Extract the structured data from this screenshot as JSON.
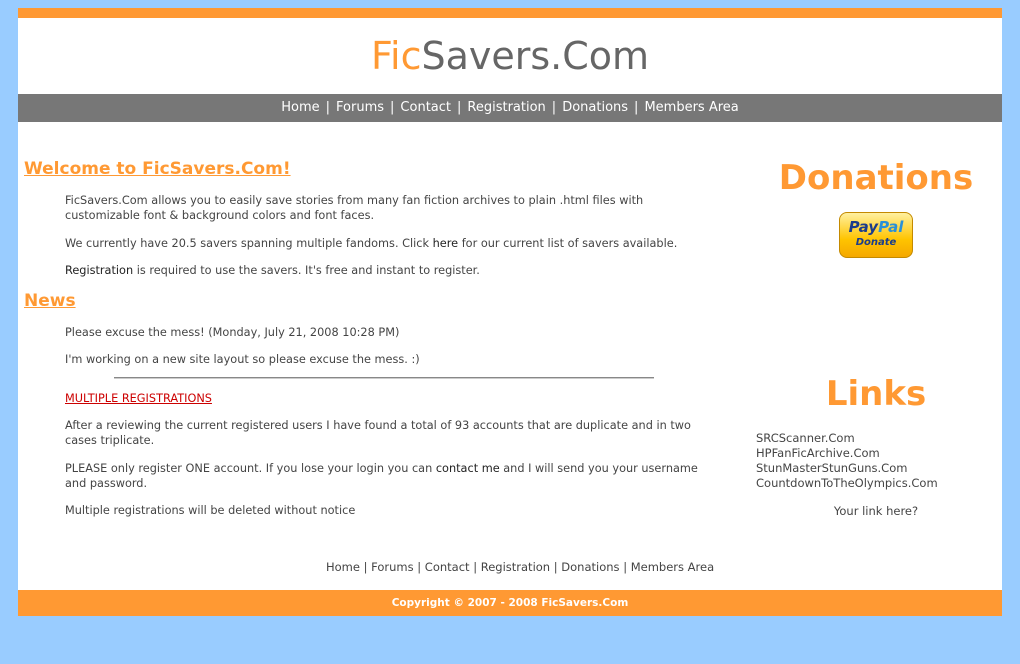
{
  "site": {
    "title_part1": "Fic",
    "title_part2": "Savers.Com",
    "colors": {
      "background": "#99ccff",
      "accent": "#ff9933",
      "nav": "#777777"
    }
  },
  "nav": {
    "items": [
      "Home",
      "Forums",
      "Contact",
      "Registration",
      "Donations",
      "Members Area"
    ],
    "separator": "|"
  },
  "main": {
    "welcome_heading": "Welcome to FicSavers.Com!",
    "welcome_p1": "FicSavers.Com allows you to easily save stories from many fan fiction archives to plain .html files with customizable font & background colors and font faces.",
    "welcome_p2_a": "We currently have 20.5 savers spanning multiple fandoms. Click ",
    "welcome_p2_link": "here",
    "welcome_p2_b": " for our current list of savers available.",
    "welcome_p3_link": "Registration",
    "welcome_p3_b": " is required to use the savers. It's free and instant to register.",
    "news_heading": "News",
    "news1_title": "Please excuse the mess! (Monday, July 21, 2008 10:28 PM)",
    "news1_body": "I'm working on a new site layout so please excuse the mess. :)",
    "news2_title": "MULTIPLE REGISTRATIONS",
    "news2_p1": "After a reviewing the current registered users I have found a total of 93 accounts that are duplicate and in two cases triplicate.",
    "news2_p2_a": "PLEASE only register ONE account. If you lose your login you can ",
    "news2_p2_link": "contact me",
    "news2_p2_b": " and I will send you your username and password.",
    "news2_p3": "Multiple registrations will be deleted without notice"
  },
  "sidebar": {
    "donations_heading": "Donations",
    "paypal_pay": "Pay",
    "paypal_pal": "Pal",
    "paypal_donate": "Donate",
    "links_heading": "Links",
    "links": [
      "SRCScanner.Com",
      "HPFanFicArchive.Com",
      "StunMasterStunGuns.Com",
      "CountdownToTheOlympics.Com"
    ],
    "your_link": "Your link here?"
  },
  "footer": {
    "nav": [
      "Home",
      "Forums",
      "Contact",
      "Registration",
      "Donations",
      "Members Area"
    ],
    "separator": "|",
    "copyright": "Copyright © 2007 - 2008 FicSavers.Com"
  }
}
